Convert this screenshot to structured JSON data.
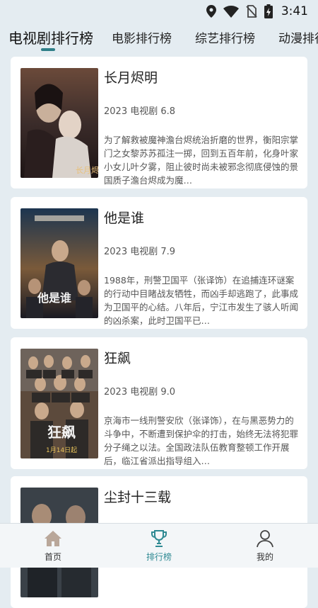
{
  "status_bar": {
    "time": "3:41",
    "icons": [
      "location-icon",
      "wifi-icon",
      "no-sim-icon",
      "battery-charging-icon"
    ]
  },
  "tabs": [
    {
      "label": "电视剧排行榜",
      "active": true
    },
    {
      "label": "电影排行榜",
      "active": false
    },
    {
      "label": "综艺排行榜",
      "active": false
    },
    {
      "label": "动漫排行",
      "active": false
    }
  ],
  "colors": {
    "accent": "#2f8a93",
    "background": "#e4ecf1",
    "card": "#ffffff"
  },
  "items": [
    {
      "title": "长月烬明",
      "meta": "2023 电视剧 6.8",
      "description": "为了解救被魔神澹台烬统治折磨的世界，衡阳宗掌门之女黎苏苏孤注一掷，回到五百年前，化身叶家小女儿叶夕雾，阻止彼时尚未被邪念彻底侵蚀的景国质子澹台烬成为魔…",
      "poster_icon": "poster-image"
    },
    {
      "title": "他是谁",
      "meta": "2023 电视剧 7.9",
      "description": "1988年，刑警卫国平（张译饰）在追捕连环谜案的行动中目睹战友牺牲，而凶手却逃跑了，此事成为卫国平的心结。八年后，宁江市发生了骇人听闻的凶杀案，此时卫国平已…",
      "poster_icon": "poster-image"
    },
    {
      "title": "狂飙",
      "meta": "2023 电视剧 9.0",
      "description": "京海市一线刑警安欣（张译饰），在与黑恶势力的斗争中，不断遭到保护伞的打击，始终无法将犯罪分子绳之以法。全国政法队伍教育整顿工作开展后，临江省派出指导组入…",
      "poster_icon": "poster-image"
    },
    {
      "title": "尘封十三载",
      "meta": "",
      "description": "",
      "poster_icon": "poster-image"
    }
  ],
  "bottom_nav": [
    {
      "label": "首页",
      "icon": "home-icon",
      "active": false
    },
    {
      "label": "排行榜",
      "icon": "trophy-icon",
      "active": true
    },
    {
      "label": "我的",
      "icon": "user-icon",
      "active": false
    }
  ]
}
